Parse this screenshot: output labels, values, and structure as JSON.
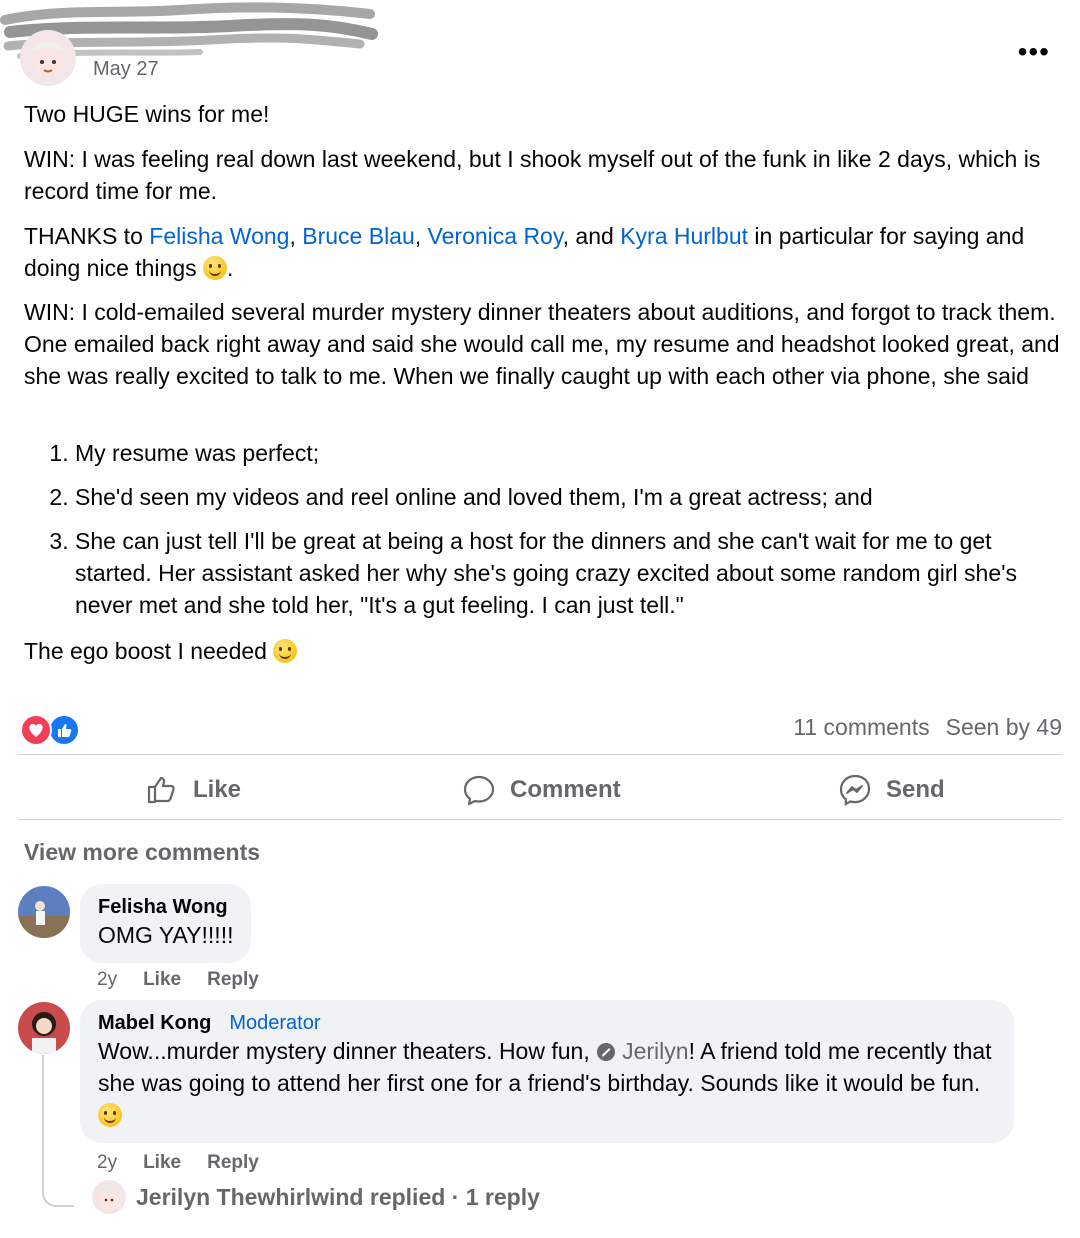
{
  "post": {
    "date": "May 27",
    "more_label": "•••",
    "headline": "Two HUGE wins for me!",
    "win1": "WIN: I was feeling real down last weekend, but I shook myself out of the funk in like 2 days, which is record time for me.",
    "thanks_prefix": "THANKS to ",
    "mentions": [
      "Felisha Wong",
      "Bruce Blau",
      "Veronica Roy",
      "Kyra Hurlbut"
    ],
    "sep1": ", ",
    "sep2": ", ",
    "sep3": ", and ",
    "thanks_suffix": " in particular for saying and doing nice things ",
    "thanks_end": ".",
    "win2": "WIN: I cold-emailed several murder mystery dinner theaters about auditions, and forgot to track them. One emailed back right away and said she would call me, my resume and headshot looked great, and she was really excited to talk to me. When we finally caught up with each other via phone, she said",
    "list": [
      "My resume was perfect;",
      "She'd seen my videos and reel online and loved them, I'm a great actress; and",
      "She can just tell I'll be great at being a host for the dinners and she can't wait for me to get started. Her assistant asked her why she's going crazy excited about some random girl she's never met and she told her, \"It's a gut feeling. I can just tell.\""
    ],
    "closing": "The ego boost I needed "
  },
  "stats": {
    "comments": "11 comments",
    "seen": "Seen by 49"
  },
  "actions": {
    "like": "Like",
    "comment": "Comment",
    "send": "Send"
  },
  "comments_section": {
    "view_more": "View more comments",
    "comments": [
      {
        "name": "Felisha Wong",
        "text": "OMG YAY!!!!!",
        "time": "2y",
        "like": "Like",
        "reply": "Reply"
      },
      {
        "name": "Mabel Kong",
        "badge": "Moderator",
        "text_before": "Wow...murder mystery dinner theaters. How fun, ",
        "mention": "Jerilyn",
        "text_after": "! A friend told me recently that she was going to attend her first one for a friend's birthday. Sounds like it would be fun. ",
        "time": "2y",
        "like": "Like",
        "reply": "Reply"
      }
    ],
    "replies_summary": "Jerilyn Thewhirlwind replied · 1 reply"
  },
  "colors": {
    "link": "#0064d1",
    "muted": "#65676b",
    "bubble": "#f0f2f5",
    "heart": "#f33e58",
    "like": "#1877f2"
  }
}
